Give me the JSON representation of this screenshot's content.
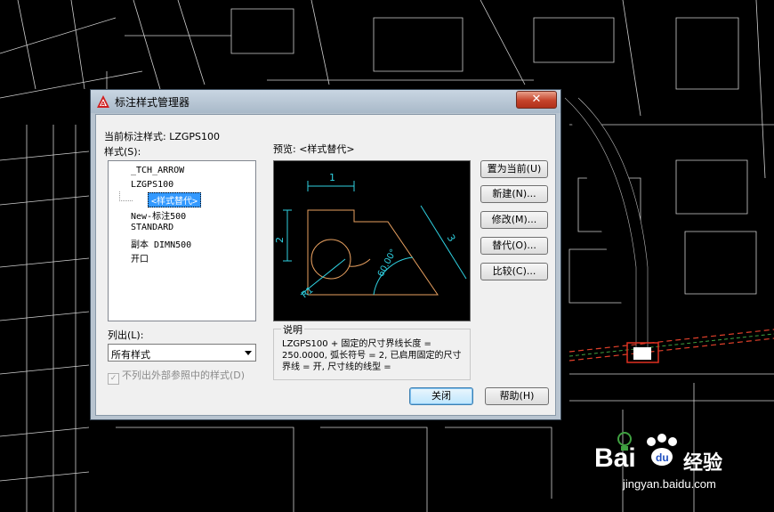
{
  "dialog": {
    "title": "标注样式管理器",
    "close_label": "✕",
    "current_style_label": "当前标注样式: LZGPS100",
    "styles_label": "样式(S):",
    "styles": [
      "_TCH_ARROW",
      "LZGPS100",
      "<样式替代>",
      "New-标注500",
      "STANDARD",
      "副本 DIMN500",
      "开口"
    ],
    "list_label": "列出(L):",
    "list_value": "所有样式",
    "exclude_xref_label": "不列出外部参照中的样式(D)",
    "preview_label": "预览: <样式替代>",
    "preview_dims": {
      "dim1": "1",
      "dim2": "2",
      "dim3": "3",
      "angle": "60.00°",
      "radius": "R1"
    },
    "description_title": "说明",
    "description_text": "LZGPS100 + 固定的尺寸界线长度 = 250.0000, 弧长符号 = 2, 已启用固定的尺寸界线 = 开, 尺寸线的线型 =",
    "buttons": {
      "set_current": "置为当前(U)",
      "new": "新建(N)...",
      "modify": "修改(M)...",
      "override": "替代(O)...",
      "compare": "比较(C)...",
      "close": "关闭",
      "help": "帮助(H)"
    }
  },
  "watermark": {
    "brand": "Bai",
    "brand_cn": "经验",
    "url": "jingyan.baidu.com"
  },
  "colors": {
    "preview_geometry": "#e8a060",
    "preview_dims": "#2fd0e0",
    "selection": "#3399ff"
  }
}
